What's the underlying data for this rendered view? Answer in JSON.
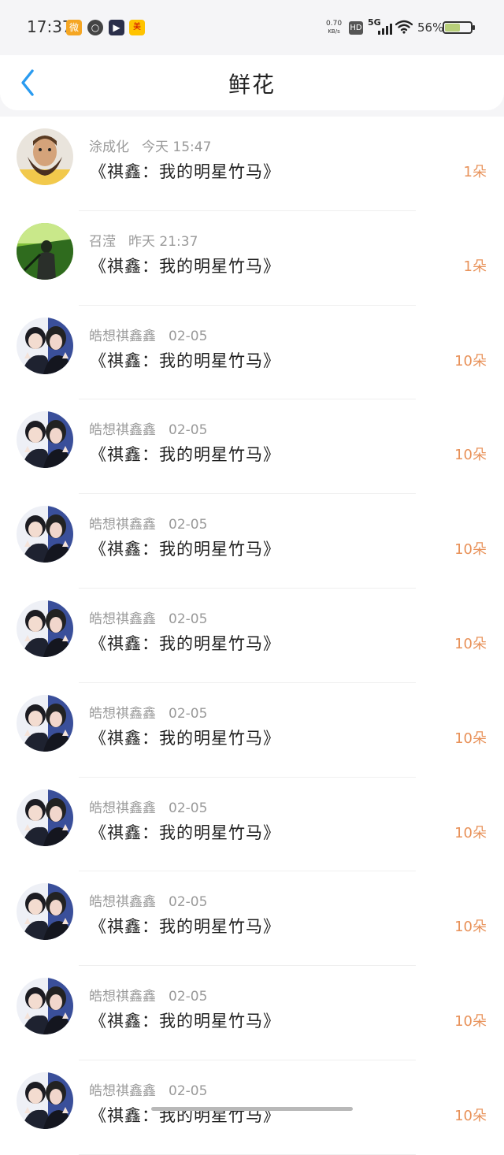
{
  "status_bar": {
    "time": "17:37",
    "net_speed_value": "0.70",
    "net_speed_unit": "KB/s",
    "hd": "HD",
    "network": "5G",
    "battery": "56%",
    "apps": [
      {
        "icon": "weibo-icon",
        "color": "#f5a623"
      },
      {
        "icon": "app-ring-icon",
        "color": "#444444"
      },
      {
        "icon": "video-play-icon",
        "color": "#2b2f4a"
      },
      {
        "icon": "meituan-icon",
        "color": "#ffc300"
      }
    ]
  },
  "header": {
    "title": "鲜花",
    "back_icon": "chevron-left-icon",
    "accent": "#2a9bf0"
  },
  "gift_list": [
    {
      "user": "涂成化",
      "time": "今天 15:47",
      "book": "《祺鑫：我的明星竹马》",
      "count": "1朵",
      "avatar": "man-mustache-avatar"
    },
    {
      "user": "召滢",
      "time": "昨天 21:37",
      "book": "《祺鑫：我的明星竹马》",
      "count": "1朵",
      "avatar": "green-photo-avatar"
    },
    {
      "user": "皓想祺鑫鑫",
      "time": "02-05",
      "book": "《祺鑫：我的明星竹马》",
      "count": "10朵",
      "avatar": "couple-photo-avatar"
    },
    {
      "user": "皓想祺鑫鑫",
      "time": "02-05",
      "book": "《祺鑫：我的明星竹马》",
      "count": "10朵",
      "avatar": "couple-photo-avatar"
    },
    {
      "user": "皓想祺鑫鑫",
      "time": "02-05",
      "book": "《祺鑫：我的明星竹马》",
      "count": "10朵",
      "avatar": "couple-photo-avatar"
    },
    {
      "user": "皓想祺鑫鑫",
      "time": "02-05",
      "book": "《祺鑫：我的明星竹马》",
      "count": "10朵",
      "avatar": "couple-photo-avatar"
    },
    {
      "user": "皓想祺鑫鑫",
      "time": "02-05",
      "book": "《祺鑫：我的明星竹马》",
      "count": "10朵",
      "avatar": "couple-photo-avatar"
    },
    {
      "user": "皓想祺鑫鑫",
      "time": "02-05",
      "book": "《祺鑫：我的明星竹马》",
      "count": "10朵",
      "avatar": "couple-photo-avatar"
    },
    {
      "user": "皓想祺鑫鑫",
      "time": "02-05",
      "book": "《祺鑫：我的明星竹马》",
      "count": "10朵",
      "avatar": "couple-photo-avatar"
    },
    {
      "user": "皓想祺鑫鑫",
      "time": "02-05",
      "book": "《祺鑫：我的明星竹马》",
      "count": "10朵",
      "avatar": "couple-photo-avatar"
    },
    {
      "user": "皓想祺鑫鑫",
      "time": "02-05",
      "book": "《祺鑫：我的明星竹马》",
      "count": "10朵",
      "avatar": "couple-photo-avatar"
    }
  ],
  "colors": {
    "count": "#e8925a",
    "meta": "#9a9a9a",
    "book": "#1e1e1e"
  }
}
